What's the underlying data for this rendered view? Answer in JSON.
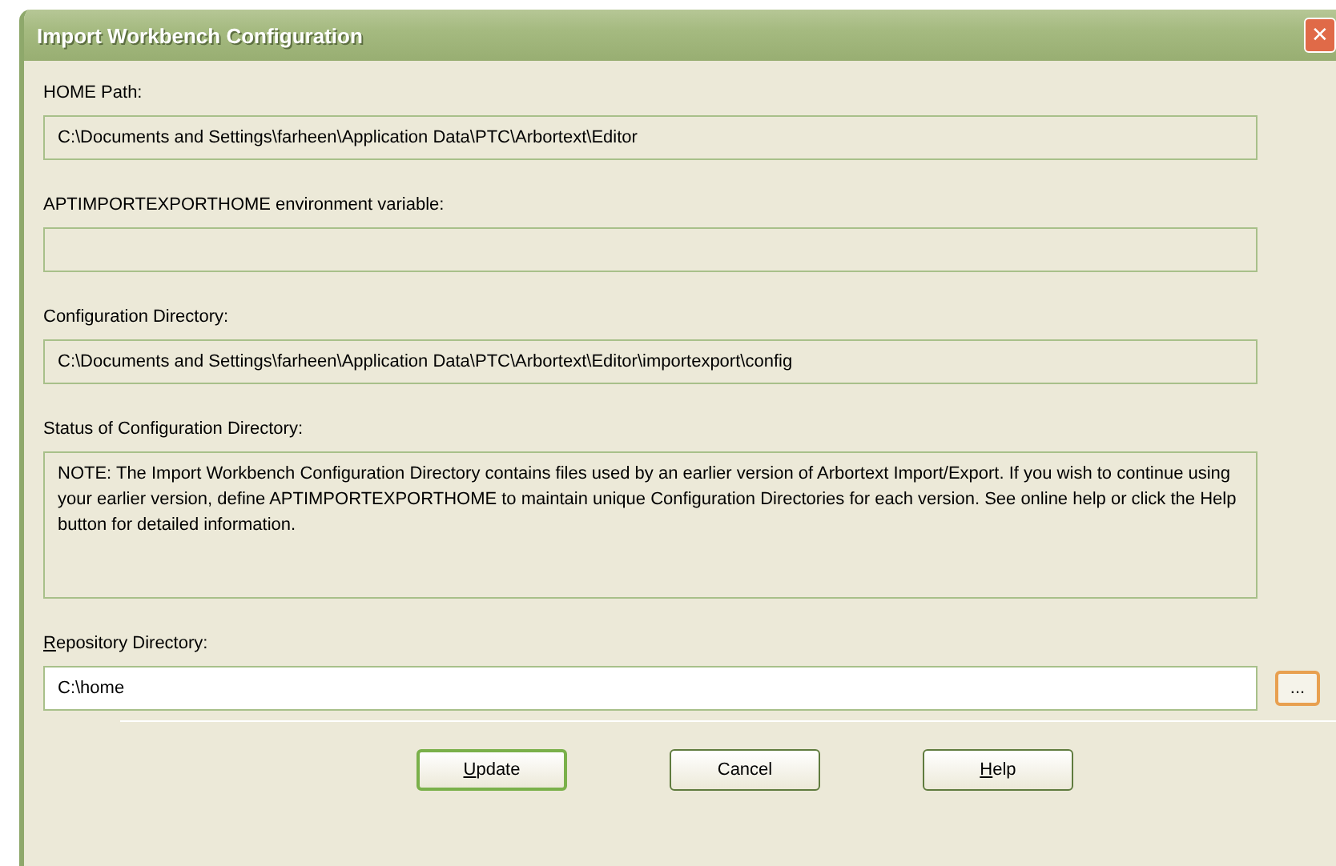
{
  "window": {
    "title": "Import Workbench Configuration",
    "close_icon": "✕"
  },
  "fields": [
    {
      "label": "HOME Path:",
      "underline_first": false,
      "value": "C:\\Documents and Settings\\farheen\\Application Data\\PTC\\Arbortext\\Editor",
      "kind": "readonly"
    },
    {
      "label": "APTIMPORTEXPORTHOME environment variable:",
      "underline_first": false,
      "kind": "readonly"
    },
    {
      "label": "Configuration Directory:",
      "underline_first": false,
      "value": "C:\\Documents and Settings\\farheen\\Application Data\\PTC\\Arbortext\\Editor\\importexport\\config",
      "kind": "readonly"
    },
    {
      "label": "Status of Configuration Directory:",
      "underline_first": false,
      "value": "NOTE: The Import Workbench Configuration Directory contains files used by an earlier version of Arbortext Import/Export.  If you wish to continue using your earlier version, define APTIMPORTEXPORTHOME to maintain unique Configuration Directories for each version.  See online help or click the Help button for detailed information.",
      "kind": "note"
    },
    {
      "label": "Repository Directory:",
      "underline_first": true,
      "value": "C:\\home",
      "kind": "editable",
      "browse": "..."
    }
  ],
  "buttons": [
    {
      "label": "Update",
      "underline_first": true,
      "default": true
    },
    {
      "label": "Cancel",
      "underline_first": false,
      "default": false
    },
    {
      "label": "Help",
      "underline_first": true,
      "default": false
    }
  ]
}
